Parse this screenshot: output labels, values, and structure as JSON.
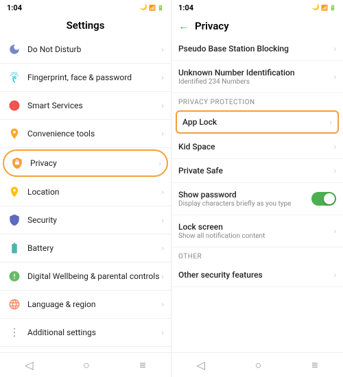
{
  "left": {
    "status": {
      "time": "1:04",
      "icons": "📶"
    },
    "header": "Settings",
    "items": [
      {
        "id": "do-not-disturb",
        "label": "Do Not Disturb",
        "icon": "moon",
        "active": false
      },
      {
        "id": "fingerprint",
        "label": "Fingerprint, face & password",
        "icon": "fingerprint",
        "active": false
      },
      {
        "id": "smart-services",
        "label": "Smart Services",
        "icon": "smart",
        "active": false
      },
      {
        "id": "convenience-tools",
        "label": "Convenience tools",
        "icon": "convenience",
        "active": false
      },
      {
        "id": "privacy",
        "label": "Privacy",
        "icon": "privacy",
        "active": true
      },
      {
        "id": "location",
        "label": "Location",
        "icon": "location",
        "active": false
      },
      {
        "id": "security",
        "label": "Security",
        "icon": "security",
        "active": false
      },
      {
        "id": "battery",
        "label": "Battery",
        "icon": "battery",
        "active": false
      },
      {
        "id": "digital-wellbeing",
        "label": "Digital Wellbeing & parental controls",
        "icon": "wellbeing",
        "active": false
      },
      {
        "id": "language",
        "label": "Language & region",
        "icon": "language",
        "active": false
      },
      {
        "id": "additional-settings",
        "label": "Additional settings",
        "icon": "additional",
        "active": false
      }
    ],
    "nav": [
      "◁",
      "○",
      "≡"
    ]
  },
  "right": {
    "status": {
      "time": "1:04"
    },
    "back_label": "←",
    "title": "Privacy",
    "items": [
      {
        "id": "pseudo-base",
        "title": "Pseudo Base Station Blocking",
        "subtitle": "",
        "has_chevron": true
      },
      {
        "id": "unknown-number",
        "title": "Unknown Number Identification",
        "subtitle": "Identified 234 Numbers",
        "has_chevron": true
      }
    ],
    "privacy_section_label": "PRIVACY PROTECTION",
    "privacy_items": [
      {
        "id": "app-lock",
        "title": "App Lock",
        "subtitle": "",
        "has_chevron": true,
        "highlighted": true
      },
      {
        "id": "kid-space",
        "title": "Kid Space",
        "subtitle": "",
        "has_chevron": true
      },
      {
        "id": "private-safe",
        "title": "Private Safe",
        "subtitle": "",
        "has_chevron": true
      },
      {
        "id": "show-password",
        "title": "Show password",
        "subtitle": "Display characters briefly as you type",
        "has_toggle": true,
        "toggle_on": true
      },
      {
        "id": "lock-screen",
        "title": "Lock screen",
        "subtitle": "Show all notification content",
        "has_chevron": true
      }
    ],
    "other_section_label": "OTHER",
    "other_items": [
      {
        "id": "other-security",
        "title": "Other security features",
        "subtitle": "",
        "has_chevron": true
      }
    ],
    "nav": [
      "◁",
      "○",
      "≡"
    ]
  }
}
